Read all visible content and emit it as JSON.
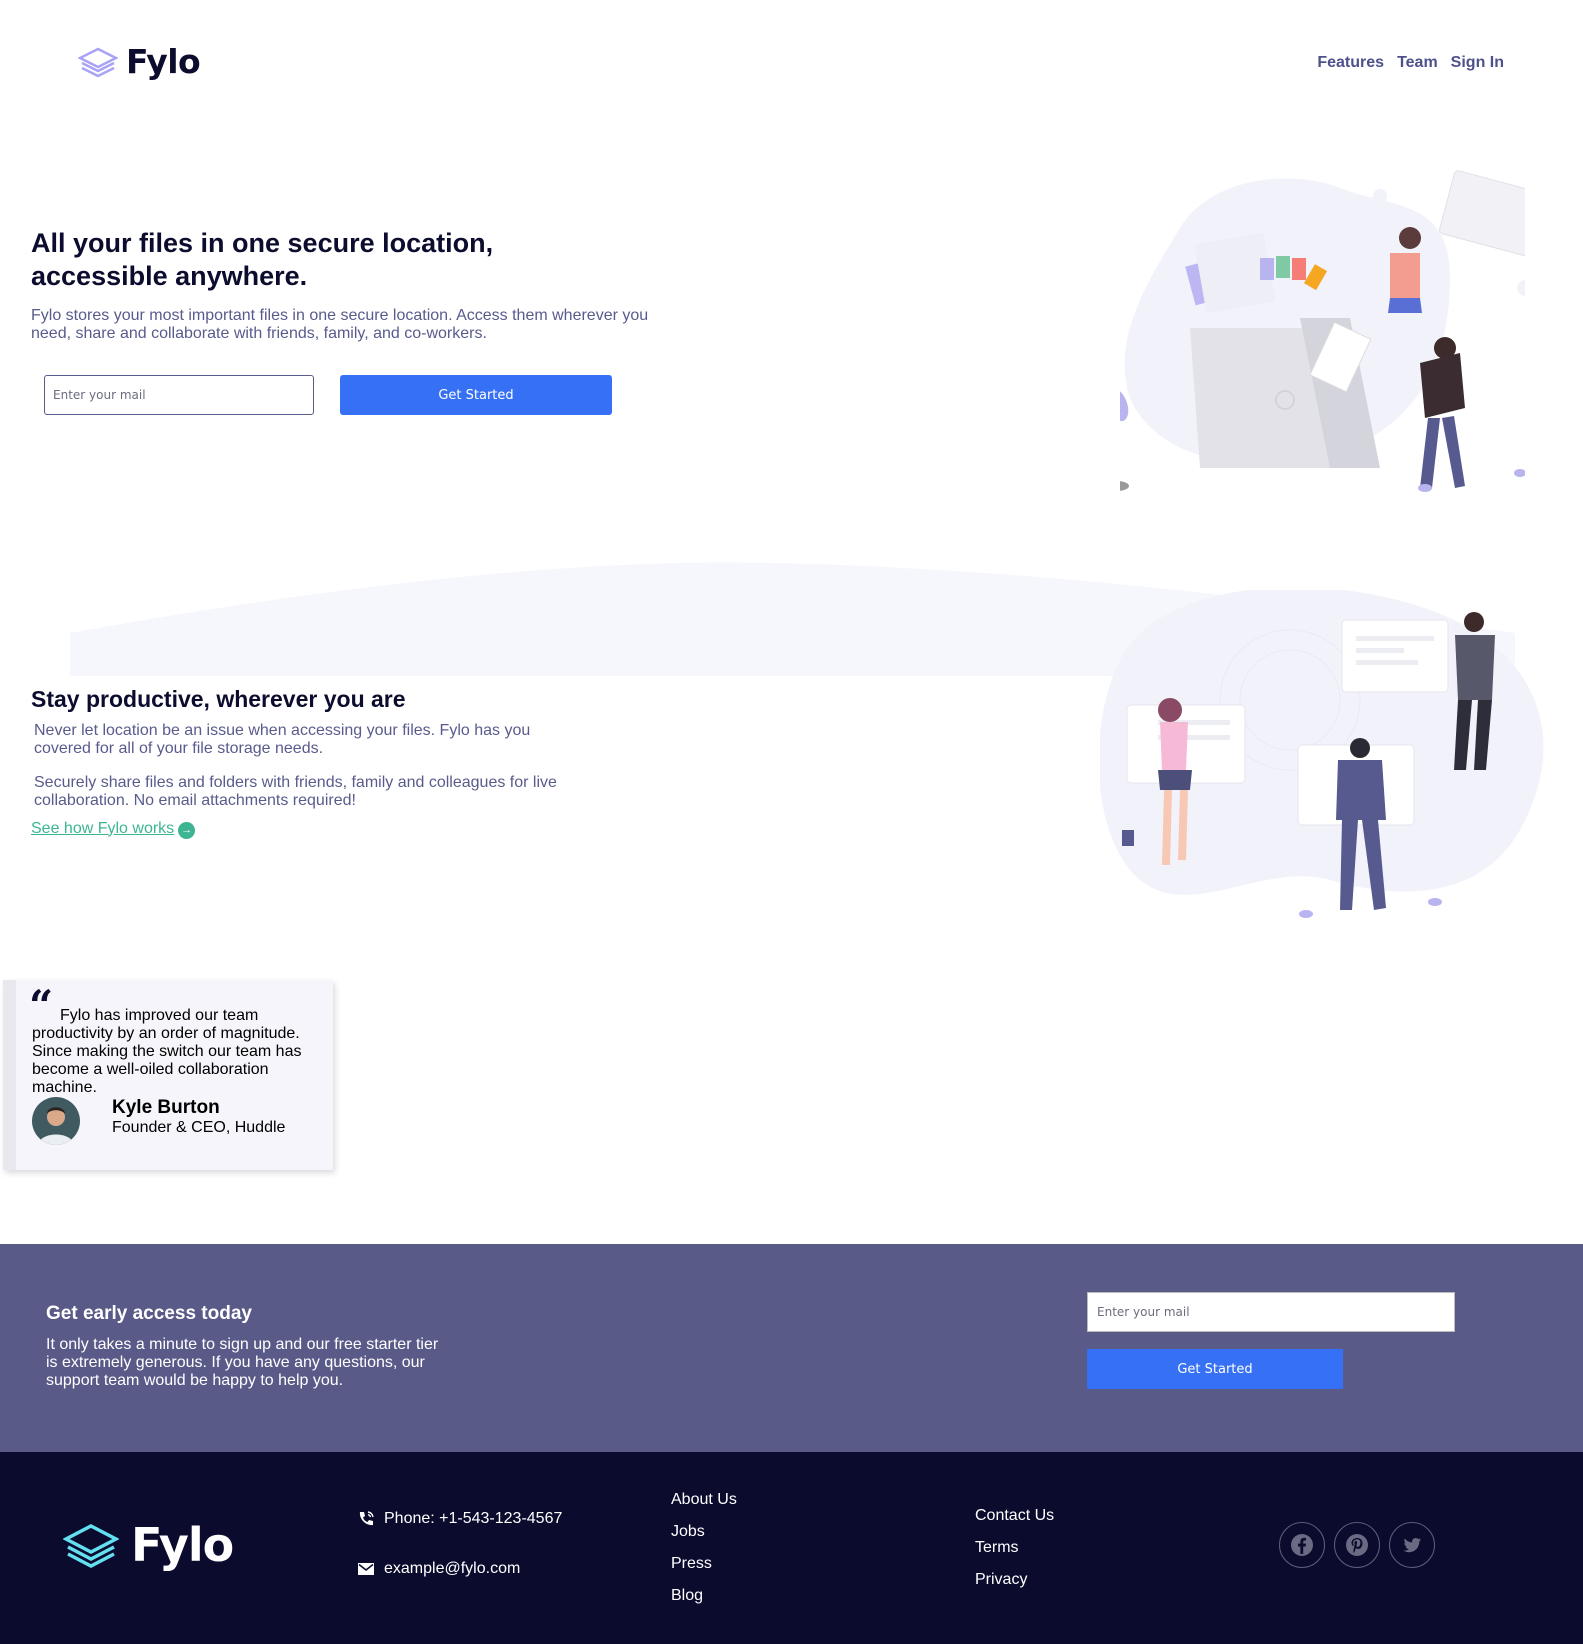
{
  "header": {
    "logo_text": "Fylo",
    "nav": [
      {
        "label": "Features"
      },
      {
        "label": "Team"
      },
      {
        "label": "Sign In"
      }
    ]
  },
  "hero": {
    "title": "All your files in one secure location, accessible anywhere.",
    "subtitle": "Fylo stores your most important files in one secure location. Access them wherever you need, share and collaborate with friends, family, and co-workers.",
    "email_placeholder": "Enter your mail",
    "button_label": "Get Started"
  },
  "productive": {
    "title": "Stay productive, wherever you are",
    "paragraph1": "Never let location be an issue when accessing your files. Fylo has you covered for all of your file storage needs.",
    "paragraph2": "Securely share files and folders with friends, family and colleagues for live collaboration. No email attachments required!",
    "link_label": "See how Fylo works",
    "link_icon": "arrow-right-icon"
  },
  "testimonial": {
    "quote": "Fylo has improved our team productivity by an order of magnitude. Since making the switch our team has become a well-oiled collaboration machine.",
    "name": "Kyle Burton",
    "role": "Founder & CEO, Huddle"
  },
  "early_access": {
    "title": "Get early access today",
    "text": "It only takes a minute to sign up and our free starter tier is extremely generous. If you have any questions, our support team would be happy to help you.",
    "email_placeholder": "Enter your mail",
    "button_label": "Get Started"
  },
  "footer": {
    "logo_text": "Fylo",
    "phone": "Phone: +1-543-123-4567",
    "email": "example@fylo.com",
    "links_col1": [
      "About Us",
      "Jobs",
      "Press",
      "Blog"
    ],
    "links_col2": [
      "Contact Us",
      "Terms",
      "Privacy"
    ],
    "socials": [
      "facebook-icon",
      "pinterest-icon",
      "twitter-icon"
    ]
  },
  "colors": {
    "navy": "#0c0d2e",
    "muted": "#585b8c",
    "primary": "#3670f5",
    "accent": "#3db592",
    "cta_bg": "#5a5a89",
    "footer_bg": "#0b0b2e"
  }
}
